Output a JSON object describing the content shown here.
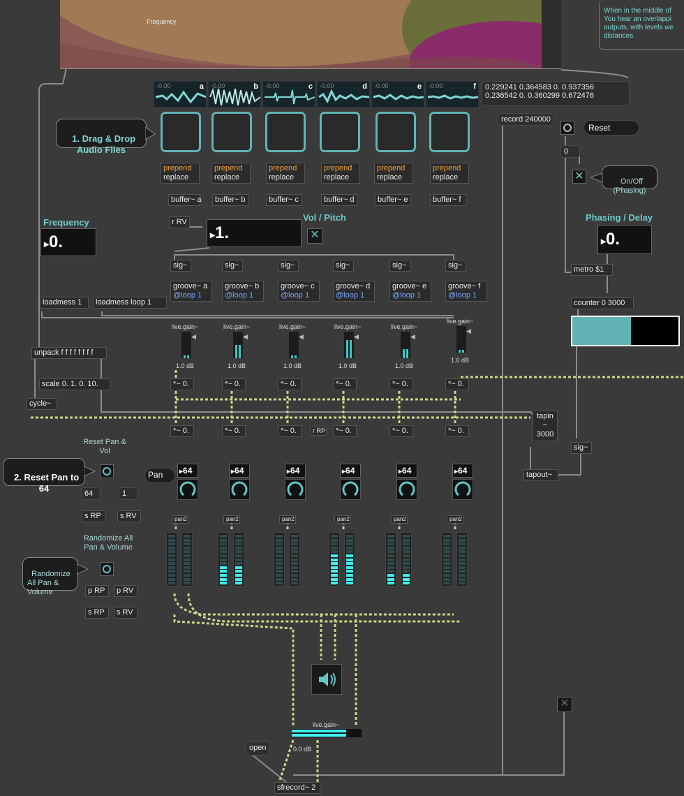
{
  "top_panel": {
    "frequency_label": "Frequency"
  },
  "info_text": "When in the middle of\nYou hear an overlappi\noutputs, with levels we\ndistances.",
  "buffers": [
    {
      "letter": "a",
      "db": "-0.00",
      "prepend": "prepend",
      "replace": "replace",
      "buffer": "buffer~ a"
    },
    {
      "letter": "b",
      "db": "-0.00",
      "prepend": "prepend",
      "replace": "replace",
      "buffer": "buffer~ b"
    },
    {
      "letter": "c",
      "db": "-0.00",
      "prepend": "prepend",
      "replace": "replace",
      "buffer": "buffer~ c"
    },
    {
      "letter": "d",
      "db": "-0.00",
      "prepend": "prepend",
      "replace": "replace",
      "buffer": "buffer~ d"
    },
    {
      "letter": "e",
      "db": "-0.00",
      "prepend": "prepend",
      "replace": "replace",
      "buffer": "buffer~ e"
    },
    {
      "letter": "f",
      "db": "-0.00",
      "prepend": "prepend",
      "replace": "replace",
      "buffer": "buffer~ f"
    }
  ],
  "values_message": {
    "line1": "0.229241 0.364583 0. 0.937356",
    "line2": "0.236542 0. 0.360299 0.672476"
  },
  "callouts": {
    "drag_drop": "1. Drag & Drop\nAudio Flies",
    "reset_pan": "2. Reset Pan to\n64",
    "randomize": "Randomize\nAll Pan &\nVolume",
    "onoff": "On/Off\n(Phasing)",
    "reset": "Reset"
  },
  "record_msg": "record 240000",
  "zero_msg": "0",
  "headings": {
    "frequency": "Frequency",
    "vol_pitch": "Vol / Pitch",
    "phasing": "Phasing / Delay"
  },
  "numboxes": {
    "frequency": "0.",
    "vol_pitch": "1.",
    "phasing": "0."
  },
  "objects": {
    "r_rv": "r RV",
    "loadmess1": "loadmess 1",
    "loadmess_loop": "loadmess loop 1",
    "unpack": "unpack f f f f f f f f",
    "scale": "scale 0. 1. 0. 10.",
    "cycle": "cycle~",
    "metro": "metro $1",
    "counter": "counter 0 3000",
    "tapin": "tapin ~",
    "tapin_val": "3000",
    "tapout": "tapout~",
    "sig_right": "sig~",
    "r_rp": "r RP",
    "sfrecord": "sfrecord~ 2",
    "open": "open"
  },
  "channels": [
    {
      "sig": "sig~",
      "groove": "groove~ a",
      "loop": "@loop 1",
      "gain_label": "live.gain~",
      "gain_db": "1.0 dB",
      "mul1": "*~ 0.",
      "mul2": "*~ 0.",
      "pan_val": "64",
      "pan2": "pan2",
      "level": 0
    },
    {
      "sig": "sig~",
      "groove": "groove~ b",
      "loop": "@loop 1",
      "gain_label": "live.gain~",
      "gain_db": "1.0 dB",
      "mul1": "*~ 0.",
      "mul2": "*~ 0.",
      "pan_val": "64",
      "pan2": "pan2",
      "level": 0.45
    },
    {
      "sig": "sig~",
      "groove": "groove~ c",
      "loop": "@loop 1",
      "gain_label": "live.gain~",
      "gain_db": "1.0 dB",
      "mul1": "*~ 0.",
      "mul2": "*~ 0.",
      "pan_val": "64",
      "pan2": "pan2",
      "level": 0
    },
    {
      "sig": "sig~",
      "groove": "groove~ d",
      "loop": "@loop 1",
      "gain_label": "live.gain~",
      "gain_db": "1.0 dB",
      "mul1": "*~ 0.",
      "mul2": "*~ 0.",
      "pan_val": "64",
      "pan2": "pan2",
      "level": 0.65
    },
    {
      "sig": "sig~",
      "groove": "groove~ e",
      "loop": "@loop 1",
      "gain_label": "live.gain~",
      "gain_db": "1.0 dB",
      "mul1": "*~ 0.",
      "mul2": "*~ 0.",
      "pan_val": "64",
      "pan2": "pan2",
      "level": 0.25
    },
    {
      "sig": "sig~",
      "groove": "groove~ f",
      "loop": "@loop 1",
      "gain_label": "live.gain~",
      "gain_db": "1.0 dB",
      "mul1": "*~ 0.",
      "mul2": "*~ 0.",
      "pan_val": "64",
      "pan2": "pan2",
      "level": 0
    }
  ],
  "pan_label": "Pan",
  "reset_pan_comment": "Reset Pan &\nVol",
  "reset_values": [
    "64",
    "1"
  ],
  "send_rp": "s RP",
  "send_rv": "s RV",
  "randomize_comment": "Randomize All\nPan & Volume",
  "p_rp": "p RP",
  "p_rv": "p RV",
  "master_gain": {
    "label": "live.gain~",
    "db": "0.0 dB"
  },
  "colors": {
    "accent": "#62c7c7",
    "background": "#3a3a3a",
    "meter": "#3ef0f0",
    "object_keyword": "#f0a23b"
  },
  "icons": {
    "speaker": "speaker-icon",
    "toggle": "x-toggle-icon"
  }
}
